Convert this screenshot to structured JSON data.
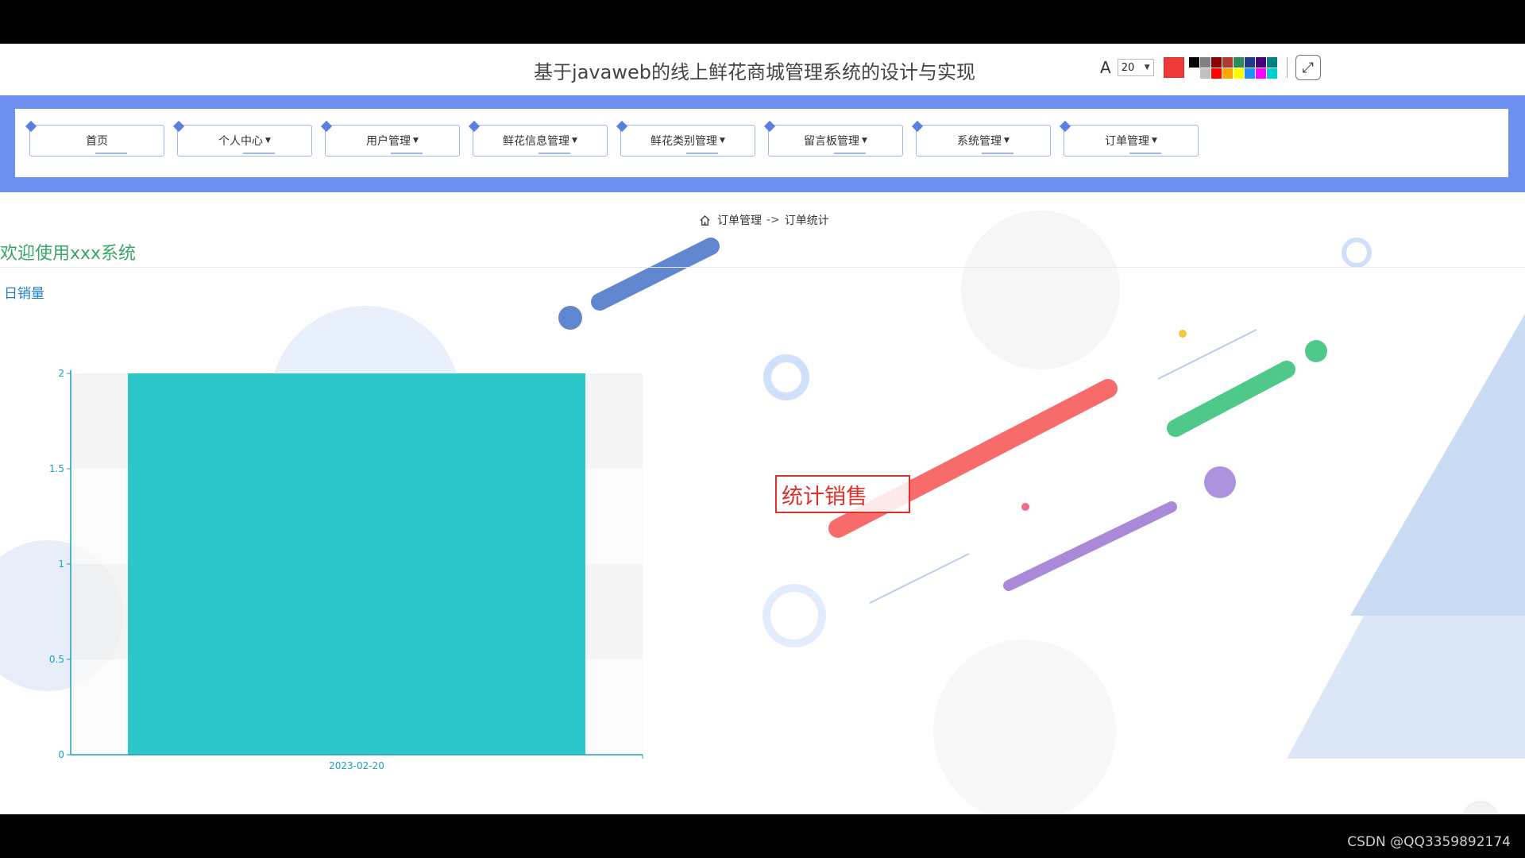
{
  "page": {
    "title": "基于javaweb的线上鲜花商城管理系统的设计与实现",
    "welcome": "欢迎使用xxx系统",
    "chart_title": "日销量"
  },
  "annotation_toolbar": {
    "font_icon": "A",
    "font_size": "20",
    "current_color": "#f03a3a",
    "palette": [
      "#000000",
      "#808080",
      "#8b0000",
      "#b03a2e",
      "#2e8b57",
      "#1e3a8a",
      "#4b0082",
      "#008080",
      "#ffffff",
      "#c0c0c0",
      "#ff0000",
      "#ffa500",
      "#ffff00",
      "#1e90ff",
      "#ff00ff",
      "#00ced1"
    ],
    "expand_icon": "expand-icon"
  },
  "nav": {
    "items": [
      {
        "label": "首页",
        "has_dropdown": false
      },
      {
        "label": "个人中心",
        "has_dropdown": true
      },
      {
        "label": "用户管理",
        "has_dropdown": true
      },
      {
        "label": "鲜花信息管理",
        "has_dropdown": true
      },
      {
        "label": "鲜花类别管理",
        "has_dropdown": true
      },
      {
        "label": "留言板管理",
        "has_dropdown": true
      },
      {
        "label": "系统管理",
        "has_dropdown": true
      },
      {
        "label": "订单管理",
        "has_dropdown": true
      }
    ]
  },
  "breadcrumb": {
    "parent": "订单管理",
    "separator": "->",
    "current": "订单统计"
  },
  "annotation_text": "统计销售",
  "watermark": "CSDN @QQ3359892174",
  "colors": {
    "nav_band": "#6d8ff0",
    "bar": "#2ec7c9",
    "axis": "#1fa0c0",
    "welcome": "#3aa56a",
    "chart_title": "#1f7fd0",
    "annotation": "#d9322e"
  },
  "chart_data": {
    "type": "bar",
    "categories": [
      "2023-02-20"
    ],
    "values": [
      2
    ],
    "title": "日销量",
    "xlabel": "",
    "ylabel": "",
    "ylim": [
      0,
      2
    ],
    "yticks": [
      0,
      0.5,
      1,
      1.5,
      2
    ],
    "grid": true,
    "legend": "none"
  }
}
